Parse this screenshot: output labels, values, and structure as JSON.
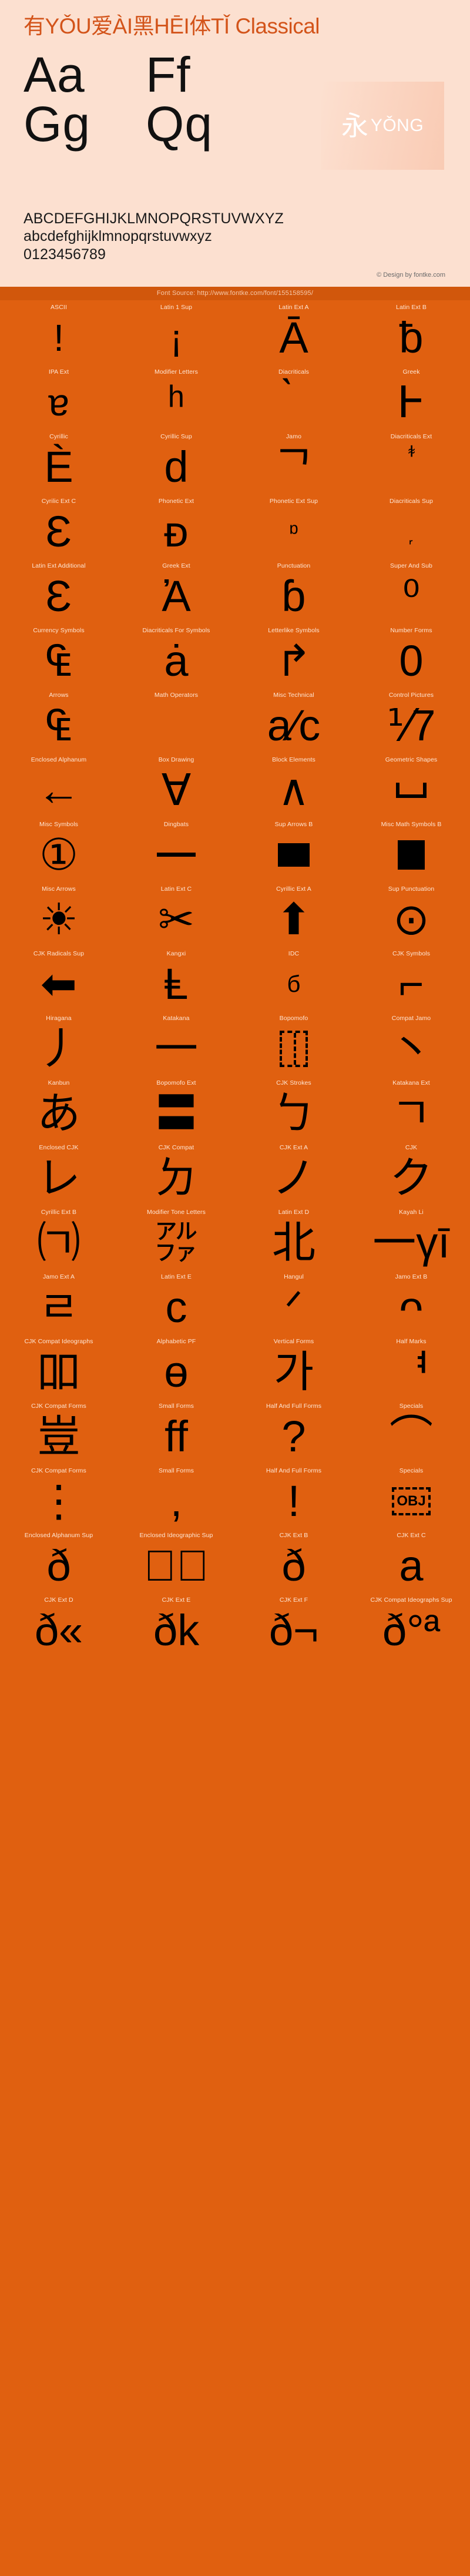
{
  "header": {
    "title": "有YǑU爱ÀI黑HĒI体TǏ Classical",
    "title_color": "#d3541a",
    "panel_bg": "#fce0d0",
    "sample_rows": [
      [
        "Aa",
        "Ff"
      ],
      [
        "Gg",
        "Qq"
      ]
    ],
    "yong": {
      "han": "永",
      "pinyin": "YǑNG"
    },
    "alphabet_upper": "ABCDEFGHIJKLMNOPQRSTUVWXYZ",
    "alphabet_lower": "abcdefghijklmnopqrstuvwxyz",
    "digits": "0123456789",
    "credit": "© Design by fontke.com"
  },
  "source_bar": {
    "text": "Font Source: http://www.fontke.com/font/155158595/",
    "bg": "#d1570c",
    "color": "#f6c9ab"
  },
  "grid": {
    "bg": "#e06010",
    "label_color": "#ffe6d4",
    "glyph_color": "#000000",
    "rows": [
      [
        {
          "label": "ASCII",
          "glyph": "!",
          "size": "lg",
          "shape": ""
        },
        {
          "label": "Latin 1 Sup",
          "glyph": "¡",
          "size": "lg",
          "shape": ""
        },
        {
          "label": "Latin Ext A",
          "glyph": "Ā",
          "size": "xl",
          "shape": ""
        },
        {
          "label": "Latin Ext B",
          "glyph": "ƀ",
          "size": "xl",
          "shape": ""
        }
      ],
      [
        {
          "label": "IPA Ext",
          "glyph": "ɐ",
          "size": "lg",
          "shape": ""
        },
        {
          "label": "Modifier Letters",
          "glyph": "ʰ",
          "size": "xl",
          "shape": ""
        },
        {
          "label": "Diacriticals",
          "glyph": "̀",
          "size": "xl",
          "shape": "grave"
        },
        {
          "label": "Greek",
          "glyph": "Ͱ",
          "size": "xl",
          "shape": ""
        }
      ],
      [
        {
          "label": "Cyrillic",
          "glyph": "Ѐ",
          "size": "xl",
          "shape": ""
        },
        {
          "label": "Cyrillic Sup",
          "glyph": "ԁ",
          "size": "xl",
          "shape": ""
        },
        {
          "label": "Jamo",
          "glyph": "ᄀ",
          "size": "xl",
          "shape": ""
        },
        {
          "label": "Diacriticals Ext",
          "glyph": "ᷬ",
          "size": "lg",
          "shape": "wavy"
        }
      ],
      [
        {
          "label": "Cyrilic Ext C",
          "glyph": "Ɛ",
          "size": "xl",
          "shape": ""
        },
        {
          "label": "Phonetic Ext",
          "glyph": "ᴆ",
          "size": "xl",
          "shape": ""
        },
        {
          "label": "Phonetic Ext Sup",
          "glyph": "ᶛ",
          "size": "sm",
          "shape": ""
        },
        {
          "label": "Diacriticals Sup",
          "glyph": "᷊",
          "size": "sm",
          "shape": ""
        }
      ],
      [
        {
          "label": "Latin Ext Additional",
          "glyph": "Ɛ",
          "size": "xl",
          "shape": ""
        },
        {
          "label": "Greek Ext",
          "glyph": "Ἀ",
          "size": "xl",
          "shape": ""
        },
        {
          "label": "Punctuation",
          "glyph": "ɓ",
          "size": "xl",
          "shape": ""
        },
        {
          "label": "Super And Sub",
          "glyph": "⁰",
          "size": "xl",
          "shape": ""
        }
      ],
      [
        {
          "label": "Currency Symbols",
          "glyph": "₠",
          "size": "xl",
          "shape": ""
        },
        {
          "label": "Diacriticals For Symbols",
          "glyph": "ȧ",
          "size": "xl",
          "shape": ""
        },
        {
          "label": "Letterlike Symbols",
          "glyph": "↱",
          "size": "xl",
          "shape": ""
        },
        {
          "label": "Number Forms",
          "glyph": "0",
          "size": "xl",
          "shape": ""
        }
      ],
      [
        {
          "label": "Arrows",
          "glyph": "₠",
          "size": "xl",
          "shape": "euro"
        },
        {
          "label": "Math Operators",
          "glyph": "",
          "size": "xl",
          "shape": "empty"
        },
        {
          "label": "Misc Technical",
          "glyph": "a⁄c",
          "size": "xl",
          "shape": ""
        },
        {
          "label": "Control Pictures",
          "glyph": "⅟7",
          "size": "xl",
          "shape": ""
        }
      ],
      [
        {
          "label": "Enclosed Alphanum",
          "glyph": "←",
          "size": "xl",
          "shape": ""
        },
        {
          "label": "Box Drawing",
          "glyph": "∀",
          "size": "xl",
          "shape": ""
        },
        {
          "label": "Block Elements",
          "glyph": "∧",
          "size": "xl",
          "shape": "overline-and"
        },
        {
          "label": "Geometric Shapes",
          "glyph": "",
          "size": "xl",
          "shape": "ubracket"
        }
      ],
      [
        {
          "label": "Misc Symbols",
          "glyph": "①",
          "size": "xl",
          "shape": ""
        },
        {
          "label": "Dingbats",
          "glyph": "",
          "size": "xl",
          "shape": "hline"
        },
        {
          "label": "Sup Arrows B",
          "glyph": "",
          "size": "xl",
          "shape": "block"
        },
        {
          "label": "Misc Math Symbols B",
          "glyph": "",
          "size": "xl",
          "shape": "geo"
        }
      ],
      [
        {
          "label": "Misc Arrows",
          "glyph": "☀",
          "size": "xl",
          "shape": ""
        },
        {
          "label": "Latin Ext C",
          "glyph": "✂",
          "size": "xl",
          "shape": ""
        },
        {
          "label": "Cyrillic Ext A",
          "glyph": "⬆",
          "size": "xl",
          "shape": "curvearrow"
        },
        {
          "label": "Sup Punctuation",
          "glyph": "⊙",
          "size": "xl",
          "shape": ""
        }
      ],
      [
        {
          "label": "CJK Radicals Sup",
          "glyph": "⬅",
          "size": "xl",
          "shape": ""
        },
        {
          "label": "Kangxi",
          "glyph": "Ⱡ",
          "size": "xl",
          "shape": ""
        },
        {
          "label": "IDC",
          "glyph": "б",
          "size": "sm",
          "shape": ""
        },
        {
          "label": "CJK Symbols",
          "glyph": "⌐",
          "size": "xl",
          "shape": ""
        }
      ],
      [
        {
          "label": "Hiragana",
          "glyph": "⼃",
          "size": "xl",
          "shape": ""
        },
        {
          "label": "Katakana",
          "glyph": "一",
          "size": "xl",
          "shape": ""
        },
        {
          "label": "Bopomofo",
          "glyph": "",
          "size": "xl",
          "shape": "dashbox"
        },
        {
          "label": "Compat Jamo",
          "glyph": "丶",
          "size": "xl",
          "shape": ""
        }
      ],
      [
        {
          "label": "Kanbun",
          "glyph": "あ",
          "size": "xl",
          "shape": ""
        },
        {
          "label": "Bopomofo Ext",
          "glyph": "〓",
          "size": "xl",
          "shape": ""
        },
        {
          "label": "CJK Strokes",
          "glyph": "ㄅ",
          "size": "xl",
          "shape": ""
        },
        {
          "label": "Katakana Ext",
          "glyph": "ㄱ",
          "size": "xl",
          "shape": ""
        }
      ],
      [
        {
          "label": "Enclosed CJK",
          "glyph": "レ",
          "size": "xl",
          "shape": ""
        },
        {
          "label": "CJK Compat",
          "glyph": "ㄉ",
          "size": "xl",
          "shape": ""
        },
        {
          "label": "CJK Ext A",
          "glyph": "ノ",
          "size": "xl",
          "shape": ""
        },
        {
          "label": "CJK",
          "glyph": "ク",
          "size": "xl",
          "shape": ""
        }
      ],
      [
        {
          "label": "Cyrillic Ext B",
          "glyph": "㈀",
          "size": "xl",
          "shape": ""
        },
        {
          "label": "Modifier Tone Letters",
          "glyph": "㌁",
          "size": "xl",
          "shape": ""
        },
        {
          "label": "Latin Ext D",
          "glyph": "北",
          "size": "xl",
          "shape": ""
        },
        {
          "label": "Kayah Li",
          "glyph": "一γī",
          "size": "xl",
          "shape": "gamma"
        }
      ],
      [
        {
          "label": "Jamo Ext A",
          "glyph": "ㄹ",
          "size": "xl",
          "shape": ""
        },
        {
          "label": "Latin Ext E",
          "glyph": "ᴄ",
          "size": "xl",
          "shape": ""
        },
        {
          "label": "Hangul",
          "glyph": "ᐟ",
          "size": "xl",
          "shape": ""
        },
        {
          "label": "Jamo Ext B",
          "glyph": "ᴖ",
          "size": "xl",
          "shape": ""
        }
      ],
      [
        {
          "label": "CJK Compat Ideographs",
          "glyph": "吅",
          "size": "xl",
          "shape": ""
        },
        {
          "label": "Alphabetic PF",
          "glyph": "ɵ",
          "size": "xl",
          "shape": ""
        },
        {
          "label": "Vertical Forms",
          "glyph": "가",
          "size": "xl",
          "shape": ""
        },
        {
          "label": "Half Marks",
          "glyph": "ᅧ",
          "size": "xl",
          "shape": ""
        }
      ],
      [
        {
          "label": "CJK Compat Forms",
          "glyph": "豈",
          "size": "xl",
          "shape": ""
        },
        {
          "label": "Small Forms",
          "glyph": "ff",
          "size": "xl",
          "shape": ""
        },
        {
          "label": "Half And Full Forms",
          "glyph": "?",
          "size": "xl",
          "shape": ""
        },
        {
          "label": "Specials",
          "glyph": "⌒",
          "size": "xl",
          "shape": ""
        }
      ],
      [
        {
          "label": "CJK Compat Forms",
          "glyph": "⋮",
          "size": "xl",
          "shape": ""
        },
        {
          "label": "Small Forms",
          "glyph": ",",
          "size": "xl",
          "shape": ""
        },
        {
          "label": "Half And Full Forms",
          "glyph": "!",
          "size": "xl",
          "shape": ""
        },
        {
          "label": "Specials",
          "glyph": "OBJ",
          "size": "xl",
          "shape": "objbox"
        }
      ],
      [
        {
          "label": "Enclosed Alphanum Sup",
          "glyph": "ð",
          "size": "xl",
          "shape": ""
        },
        {
          "label": "Enclosed Ideographic Sup",
          "glyph": "\u0000\u0000",
          "size": "xl",
          "shape": "tofu2"
        },
        {
          "label": "CJK Ext B",
          "glyph": "ð",
          "size": "xl",
          "shape": "tofu-d"
        },
        {
          "label": "CJK Ext C",
          "glyph": "a",
          "size": "xl",
          "shape": "tofu-a"
        }
      ],
      [
        {
          "label": "CJK Ext D",
          "glyph": "ð«",
          "size": "xl",
          "shape": ""
        },
        {
          "label": "CJK Ext E",
          "glyph": "ðk",
          "size": "xl",
          "shape": "tofu-k"
        },
        {
          "label": "CJK Ext F",
          "glyph": "ð¬",
          "size": "xl",
          "shape": ""
        },
        {
          "label": "CJK Compat Ideographs Sup",
          "glyph": "ð°ª",
          "size": "xl",
          "shape": ""
        }
      ]
    ]
  }
}
